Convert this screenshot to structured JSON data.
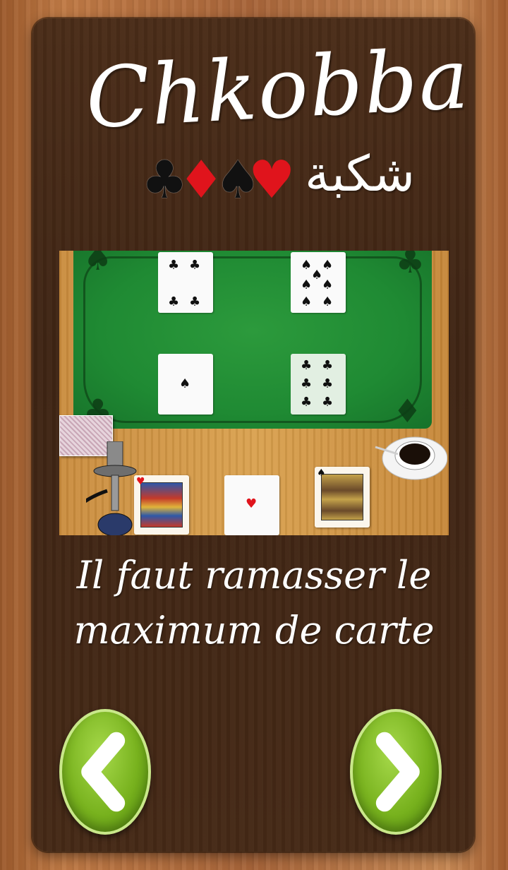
{
  "logo": {
    "title": "Chkobba",
    "arabic": "شكبة",
    "suits": [
      "♣",
      "♦",
      "♠",
      "♥"
    ]
  },
  "tutorial": {
    "instruction_line1": "Il faut ramasser le",
    "instruction_line2": "maximum de carte"
  },
  "table": {
    "center_cards": [
      {
        "suit": "♣",
        "rank": "4"
      },
      {
        "suit": "♠",
        "rank": "7"
      },
      {
        "suit": "♠",
        "rank": "1"
      },
      {
        "suit": "♣",
        "rank": "6"
      }
    ],
    "hand_cards": [
      {
        "suit": "♥",
        "rank": "R"
      },
      {
        "suit": "♥",
        "rank": "1"
      },
      {
        "suit": "♠",
        "rank": "R"
      }
    ]
  },
  "nav": {
    "prev_icon": "chevron-left-icon",
    "next_icon": "chevron-right-icon"
  },
  "colors": {
    "panel": "#452916",
    "felt": "#1f8a33",
    "button_green": "#78b21e",
    "suit_red": "#e0141c"
  }
}
